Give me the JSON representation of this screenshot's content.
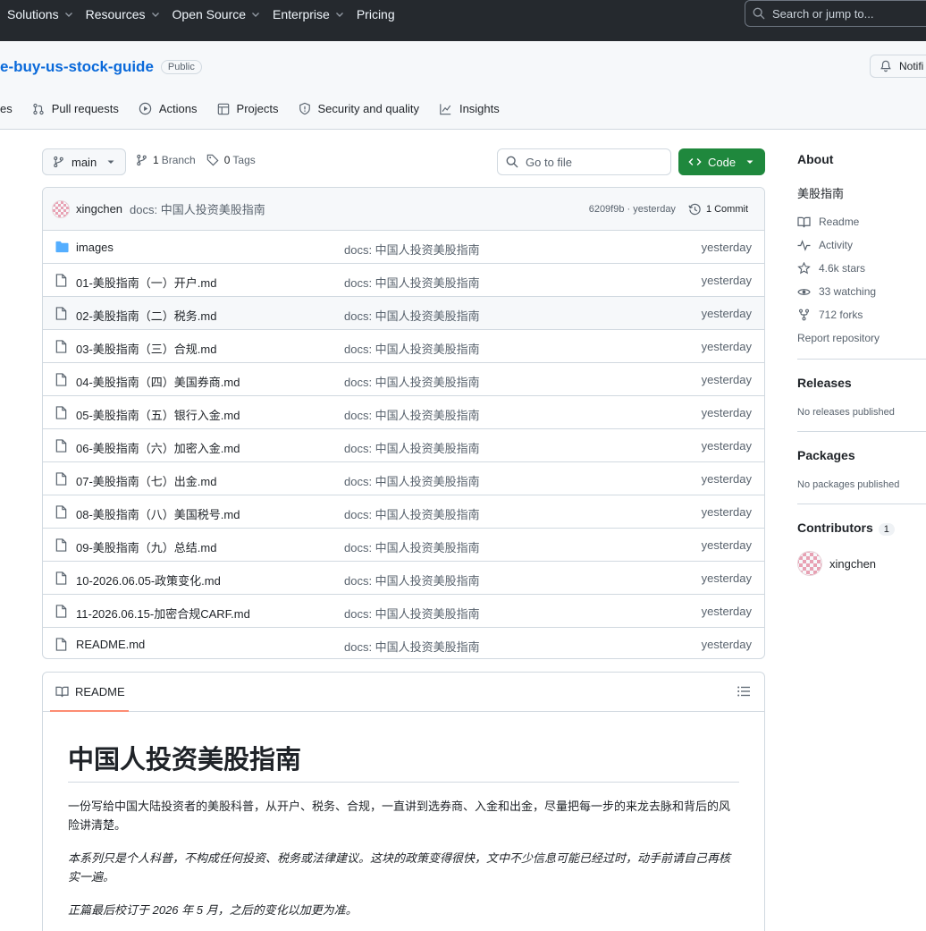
{
  "topnav": {
    "menu": [
      {
        "label": "Solutions"
      },
      {
        "label": "Resources"
      },
      {
        "label": "Open Source"
      },
      {
        "label": "Enterprise"
      },
      {
        "label": "Pricing"
      }
    ],
    "search_placeholder": "Search or jump to..."
  },
  "repo": {
    "name": "e-buy-us-stock-guide",
    "visibility": "Public",
    "notifications_label": "Notifi",
    "tabs": [
      {
        "label": "es",
        "icon": "code-icon"
      },
      {
        "label": "Pull requests",
        "icon": "git-pull-request-icon"
      },
      {
        "label": "Actions",
        "icon": "play-icon"
      },
      {
        "label": "Projects",
        "icon": "table-icon"
      },
      {
        "label": "Security and quality",
        "icon": "shield-icon"
      },
      {
        "label": "Insights",
        "icon": "graph-icon"
      }
    ]
  },
  "browser": {
    "branch": "main",
    "branch_count": "1",
    "branch_label": "Branch",
    "tag_count": "0",
    "tag_label": "Tags",
    "goto_file": "Go to file",
    "code_label": "Code"
  },
  "commit": {
    "author": "xingchen",
    "message": "docs: 中国人投资美股指南",
    "hash_time": "6209f9b · yesterday",
    "commits_label": "1 Commit"
  },
  "files": [
    {
      "name": "images",
      "type": "folder",
      "message": "docs: 中国人投资美股指南",
      "date": "yesterday"
    },
    {
      "name": "01-美股指南（一）开户.md",
      "type": "file",
      "message": "docs: 中国人投资美股指南",
      "date": "yesterday"
    },
    {
      "name": "02-美股指南（二）税务.md",
      "type": "file",
      "message": "docs: 中国人投资美股指南",
      "date": "yesterday"
    },
    {
      "name": "03-美股指南（三）合规.md",
      "type": "file",
      "message": "docs: 中国人投资美股指南",
      "date": "yesterday"
    },
    {
      "name": "04-美股指南（四）美国券商.md",
      "type": "file",
      "message": "docs: 中国人投资美股指南",
      "date": "yesterday"
    },
    {
      "name": "05-美股指南（五）银行入金.md",
      "type": "file",
      "message": "docs: 中国人投资美股指南",
      "date": "yesterday"
    },
    {
      "name": "06-美股指南（六）加密入金.md",
      "type": "file",
      "message": "docs: 中国人投资美股指南",
      "date": "yesterday"
    },
    {
      "name": "07-美股指南（七）出金.md",
      "type": "file",
      "message": "docs: 中国人投资美股指南",
      "date": "yesterday"
    },
    {
      "name": "08-美股指南（八）美国税号.md",
      "type": "file",
      "message": "docs: 中国人投资美股指南",
      "date": "yesterday"
    },
    {
      "name": "09-美股指南（九）总结.md",
      "type": "file",
      "message": "docs: 中国人投资美股指南",
      "date": "yesterday"
    },
    {
      "name": "10-2026.06.05-政策变化.md",
      "type": "file",
      "message": "docs: 中国人投资美股指南",
      "date": "yesterday"
    },
    {
      "name": "11-2026.06.15-加密合规CARF.md",
      "type": "file",
      "message": "docs: 中国人投资美股指南",
      "date": "yesterday"
    },
    {
      "name": "README.md",
      "type": "file",
      "message": "docs: 中国人投资美股指南",
      "date": "yesterday"
    }
  ],
  "readme": {
    "tab_label": "README",
    "title": "中国人投资美股指南",
    "paragraphs": [
      "一份写给中国大陆投资者的美股科普，从开户、税务、合规，一直讲到选券商、入金和出金，尽量把每一步的来龙去脉和背后的风险讲清楚。",
      "本系列只是个人科普，不构成任何投资、税务或法律建议。这块的政策变得很快，文中不少信息可能已经过时，动手前请自己再核实一遍。",
      "正篇最后校订于 2026 年 5 月，之后的变化以加更为准。"
    ]
  },
  "sidebar": {
    "about_title": "About",
    "description": "美股指南",
    "readme": "Readme",
    "activity": "Activity",
    "stars": "4.6k stars",
    "watching": "33 watching",
    "forks": "712 forks",
    "report": "Report repository",
    "releases_title": "Releases",
    "releases_text": "No releases published",
    "packages_title": "Packages",
    "packages_text": "No packages published",
    "contributors_title": "Contributors",
    "contributors_count": "1",
    "contributor_name": "xingchen"
  }
}
